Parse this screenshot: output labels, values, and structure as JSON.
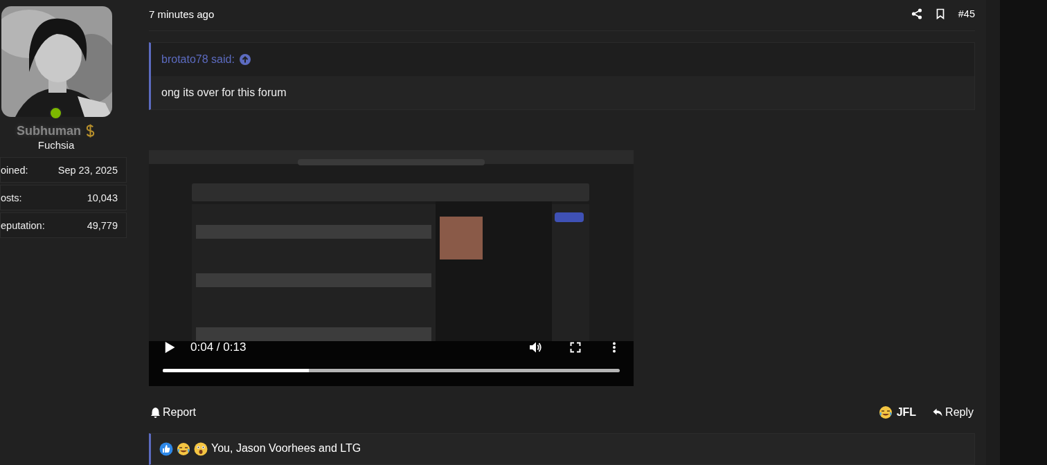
{
  "user": {
    "name": "Subhuman",
    "title": "Fuchsia",
    "online": true,
    "stats": [
      {
        "label": "oined:",
        "value": "Sep 23, 2025"
      },
      {
        "label": "osts:",
        "value": "10,043"
      },
      {
        "label": "eputation:",
        "value": "49,779"
      }
    ]
  },
  "post": {
    "time": "7 minutes ago",
    "number": "#45"
  },
  "quote": {
    "author": "brotato78 said:",
    "text": "ong its over for this forum"
  },
  "video": {
    "kind": "picture",
    "time": "0:04 / 0:13",
    "level": 0.32
  },
  "actions": {
    "report": "Report",
    "reaction": "JFL",
    "reply": "Reply"
  },
  "reactions": {
    "text": "You, Jason Voorhees and LTG"
  }
}
